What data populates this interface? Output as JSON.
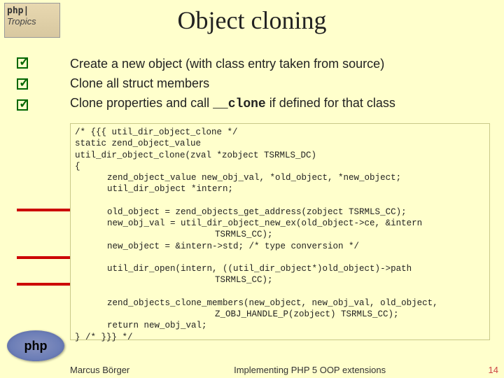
{
  "header": {
    "line1": "php|",
    "line2": "Tropics"
  },
  "title": "Object cloning",
  "bullets": {
    "b1": "Create a new object (with class entry taken from source)",
    "b2": "Clone all struct members",
    "b3_a": "Clone properties and call ",
    "b3_mono": "__clone",
    "b3_b": " if defined for that class"
  },
  "code": {
    "l1": "/* {{{ util_dir_object_clone */",
    "l2": "static zend_object_value",
    "l3": "util_dir_object_clone(zval *zobject TSRMLS_DC)",
    "l4": "{",
    "l5": "zend_object_value new_obj_val, *old_object, *new_object;",
    "l6": "util_dir_object *intern;",
    "blank1": " ",
    "l7": "old_object = zend_objects_get_address(zobject TSRMLS_CC);",
    "l8": "new_obj_val = util_dir_object_new_ex(old_object->ce, &intern",
    "l8b": "TSRMLS_CC);",
    "l9": "new_object = &intern->std; /* type conversion */",
    "blank2": " ",
    "l10": "util_dir_open(intern, ((util_dir_object*)old_object)->path",
    "l10b": "TSRMLS_CC);",
    "blank3": " ",
    "l11": "zend_objects_clone_members(new_object, new_obj_val, old_object,",
    "l11b": "Z_OBJ_HANDLE_P(zobject) TSRMLS_CC);",
    "l12": "return new_obj_val;",
    "l13": "} /* }}} */"
  },
  "logo": "php",
  "footer": {
    "author": "Marcus Börger",
    "title": "Implementing PHP 5 OOP extensions",
    "page": "14"
  }
}
